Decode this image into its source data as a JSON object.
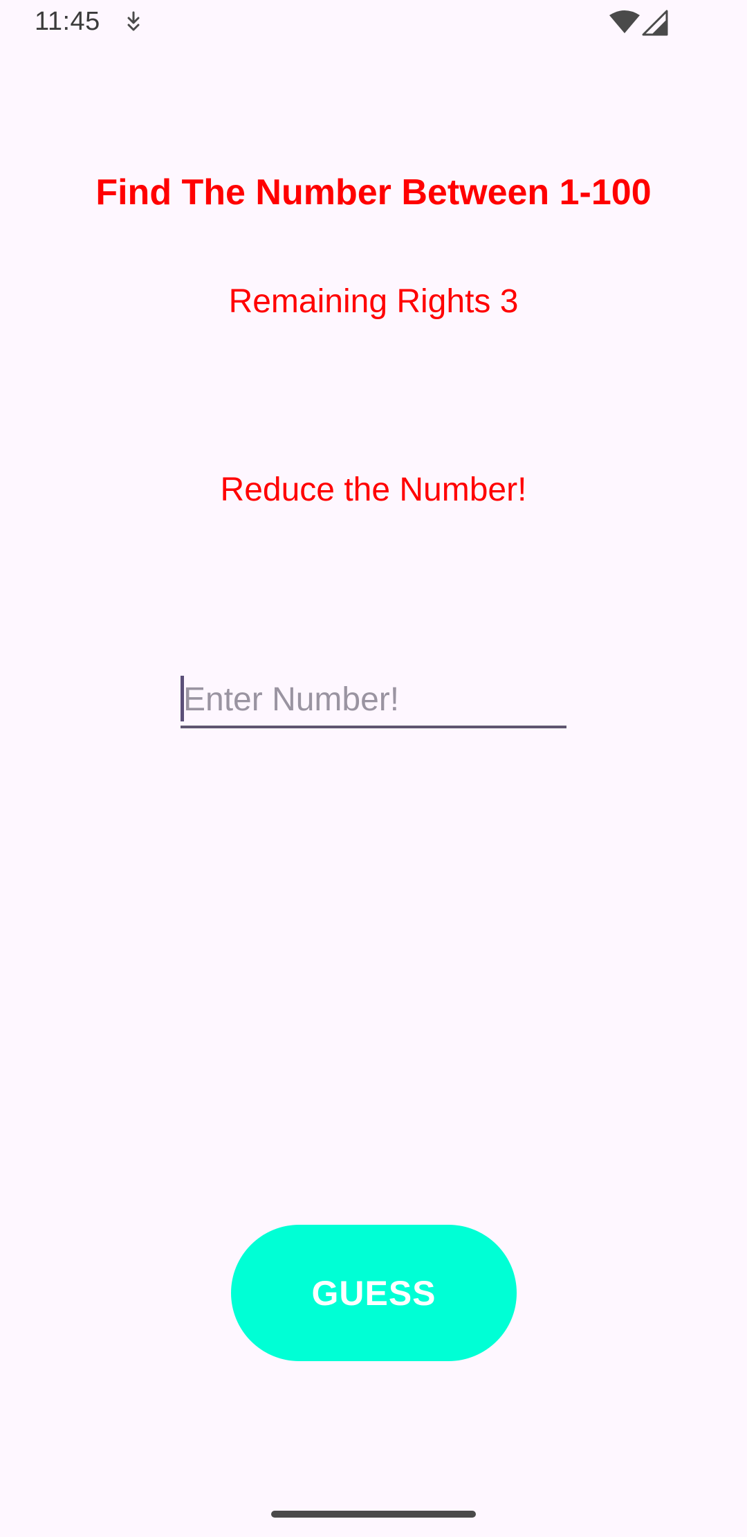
{
  "status_bar": {
    "time": "11:45",
    "icons": [
      "notification-icon",
      "wifi-icon",
      "signal-icon"
    ]
  },
  "main": {
    "title": "Find The Number Between 1-100",
    "remaining_rights": "Remaining Rights 3",
    "hint": "Reduce the Number!",
    "input": {
      "placeholder": "Enter Number!",
      "value": ""
    },
    "guess_button_label": "GUESS"
  },
  "colors": {
    "background": "#FEF7FF",
    "text_red": "#FF0000",
    "button": "#00FFD5",
    "button_text": "#FFFFFF",
    "input_underline": "#5F5670"
  }
}
